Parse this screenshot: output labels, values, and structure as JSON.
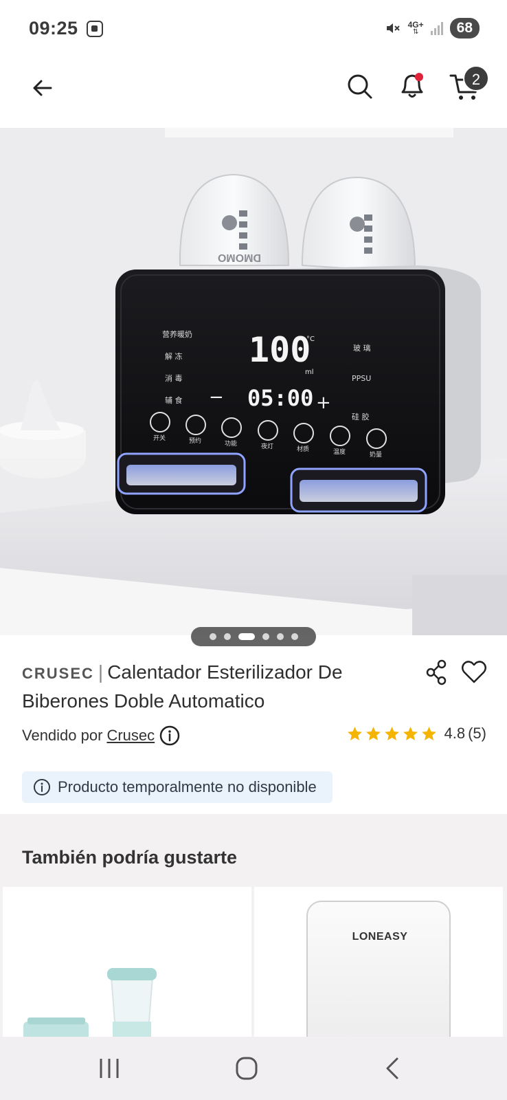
{
  "status_bar": {
    "time": "09:25",
    "network": "4G+",
    "battery": "68"
  },
  "header": {
    "cart_count": "2"
  },
  "product": {
    "carousel": {
      "total": 6,
      "active_index": 2
    },
    "brand": "CRUSEC",
    "separator": "|",
    "title": "Calentador Esterilizador De Biberones Doble Automatico",
    "sold_by_label": "Vendido por",
    "seller": "Crusec",
    "rating": "4.8",
    "review_count": "(5)",
    "stars": 5,
    "unavailable_text": "Producto temporalmente no disponible",
    "image": {
      "display_temp": "100",
      "display_temp_unit": "°C",
      "display_ml": "ml",
      "display_time": "05:00",
      "minus": "−",
      "plus": "+",
      "left_labels": [
        "营养暖奶",
        "解 冻",
        "消 毒",
        "辅 食"
      ],
      "right_labels": [
        "玻 璃",
        "PPSU",
        "硅 胶"
      ],
      "buttons": [
        "开关",
        "预约",
        "功能",
        "夜灯",
        "材质",
        "温度",
        "奶量"
      ],
      "bottle_brand": "DMOMO"
    }
  },
  "recommendations": {
    "title": "También podría gustarte",
    "items": [
      {
        "label": ""
      },
      {
        "label": "LONEASY"
      }
    ]
  },
  "colors": {
    "star": "#f5b400",
    "badge": "#3c3c3c",
    "notice_bg": "#eaf2fb",
    "section_bg": "#f4f1f2",
    "bell_dot": "#e0223a"
  }
}
